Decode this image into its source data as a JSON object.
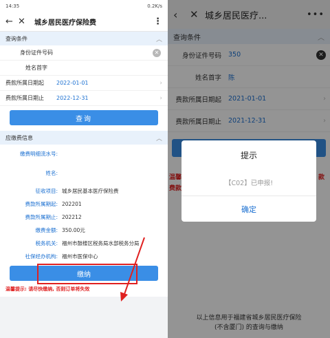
{
  "left": {
    "status": {
      "time": "14:35",
      "speed": "0.2K/s"
    },
    "title": "城乡居民医疗保险费",
    "query_section": "查询条件",
    "fields": [
      {
        "label": "身份证件号码",
        "value": ""
      },
      {
        "label": "姓名首字",
        "value": ""
      },
      {
        "label": "费款所属日期起",
        "value": "2022-01-01"
      },
      {
        "label": "费款所属日期止",
        "value": "2022-12-31"
      }
    ],
    "query_button": "查询",
    "payable_section": "应缴费信息",
    "info": [
      {
        "k": "缴费明细流水号:",
        "v": ""
      },
      {
        "k": "姓名:",
        "v": ""
      },
      {
        "k": "征收项目:",
        "v": "城乡居民基本医疗保险费"
      },
      {
        "k": "费款所属期起:",
        "v": "202201"
      },
      {
        "k": "费款所属期止:",
        "v": "202212"
      },
      {
        "k": "缴费金额:",
        "v": "350.00元"
      },
      {
        "k": "税务机关:",
        "v": "福州市鼓楼区税务局水部税务分局"
      },
      {
        "k": "社保经办机构:",
        "v": "福州市医保中心"
      }
    ],
    "pay_button": "缴纳",
    "warning": "温馨提示: 请尽快缴纳, 否则订单将失效"
  },
  "right": {
    "title": "城乡居民医疗...",
    "query_section": "查询条件",
    "fields": [
      {
        "label": "身份证件号码",
        "value": "350"
      },
      {
        "label": "姓名首字",
        "value": "陈"
      },
      {
        "label": "费款所属日期起",
        "value": "2021-01-01"
      },
      {
        "label": "费款所属日期止",
        "value": "2021-12-31"
      }
    ],
    "warn_left": "温馨\n费款所属",
    "warn_right": "款",
    "bottom_text_1": "以上信息用于福建省城乡居民医疗保险",
    "bottom_text_2": "(不含厦门) 的查询与缴纳",
    "dialog": {
      "title": "提示",
      "message": "【C02】已申报!",
      "ok": "确定"
    }
  },
  "colors": {
    "accent": "#3a8ee6",
    "link": "#1a6fd1",
    "warning": "#e02020",
    "section_bg": "#e8f1fb"
  }
}
